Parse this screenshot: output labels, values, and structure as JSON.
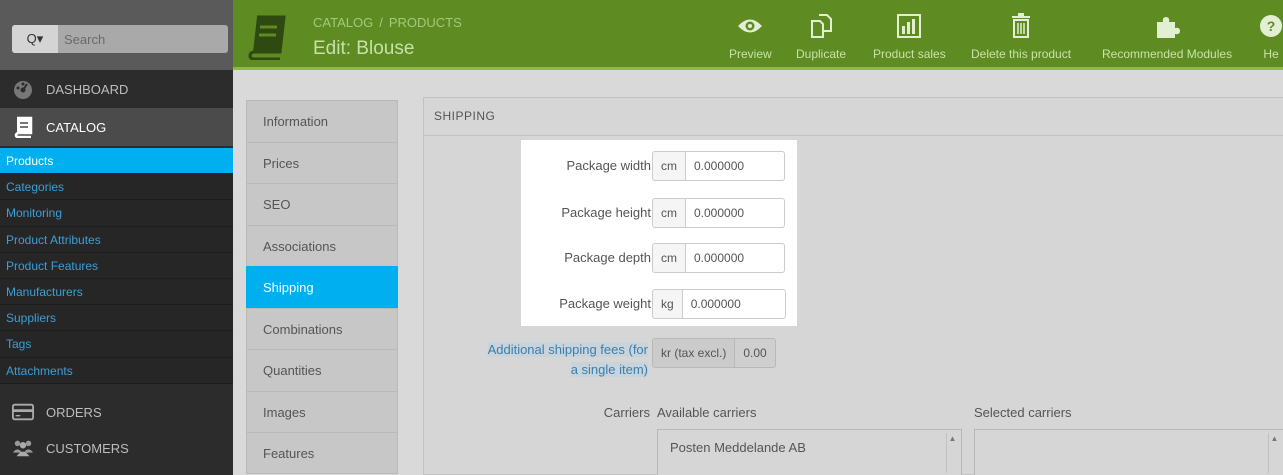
{
  "search": {
    "placeholder": "Search",
    "button_label": "Q▾"
  },
  "sidebar": {
    "sections": [
      {
        "key": "dashboard",
        "label": "DASHBOARD",
        "icon": "dashboard-gauge-icon"
      },
      {
        "key": "catalog",
        "label": "CATALOG",
        "icon": "book-icon"
      },
      {
        "key": "orders",
        "label": "ORDERS",
        "icon": "credit-card-icon"
      },
      {
        "key": "customers",
        "label": "CUSTOMERS",
        "icon": "users-icon"
      }
    ],
    "catalog_items": [
      "Products",
      "Categories",
      "Monitoring",
      "Product Attributes",
      "Product Features",
      "Manufacturers",
      "Suppliers",
      "Tags",
      "Attachments"
    ],
    "active_item": "Products"
  },
  "header": {
    "breadcrumb": [
      "CATALOG",
      "PRODUCTS"
    ],
    "breadcrumb_separator": "/",
    "title": "Edit: Blouse",
    "toolbar": [
      {
        "label": "Preview",
        "icon": "eye-icon"
      },
      {
        "label": "Duplicate",
        "icon": "duplicate-icon"
      },
      {
        "label": "Product sales",
        "icon": "bar-chart-icon"
      },
      {
        "label": "Delete this product",
        "icon": "trash-icon"
      },
      {
        "label": "Recommended Modules",
        "icon": "puzzle-icon"
      },
      {
        "label": "He",
        "icon": "help-icon"
      }
    ]
  },
  "tabs": [
    "Information",
    "Prices",
    "SEO",
    "Associations",
    "Shipping",
    "Combinations",
    "Quantities",
    "Images",
    "Features"
  ],
  "active_tab": "Shipping",
  "panel": {
    "heading": "SHIPPING",
    "dimensions": [
      {
        "label": "Package width",
        "unit": "cm",
        "value": "0.000000"
      },
      {
        "label": "Package height",
        "unit": "cm",
        "value": "0.000000"
      },
      {
        "label": "Package depth",
        "unit": "cm",
        "value": "0.000000"
      },
      {
        "label": "Package weight",
        "unit": "kg",
        "value": "0.000000"
      }
    ],
    "additional_fees": {
      "label_line1": "Additional shipping fees (for",
      "label_line2": "a single item)",
      "unit": "kr (tax excl.)",
      "value": "0.00"
    },
    "carriers": {
      "label": "Carriers",
      "available_title": "Available carriers",
      "selected_title": "Selected carriers",
      "available_items": [
        "Posten Meddelande AB"
      ],
      "selected_items": []
    }
  },
  "colors": {
    "header_green": "#5e8b22",
    "accent_blue": "#00aff0",
    "sidebar_dark": "#2c2c2c",
    "link_blue": "#3c9fd6"
  }
}
